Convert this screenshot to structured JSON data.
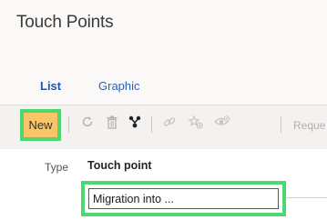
{
  "header": {
    "title": "Touch Points"
  },
  "tabs": [
    {
      "label": "List",
      "active": true
    },
    {
      "label": "Graphic",
      "active": false
    }
  ],
  "toolbar": {
    "new_label": "New",
    "icons": [
      "refresh-icon",
      "delete-icon",
      "hierarchy-icon",
      "link-icon",
      "favorite-add-icon",
      "watch-icon"
    ],
    "truncated_label": "Reque"
  },
  "table": {
    "columns": [
      "Type",
      "Touch point"
    ],
    "new_row_value": "Migration into ..."
  },
  "colors": {
    "highlight_border": "#4cd771",
    "new_button_bg": "#f9c56b",
    "tab_link": "#2b63b4"
  }
}
